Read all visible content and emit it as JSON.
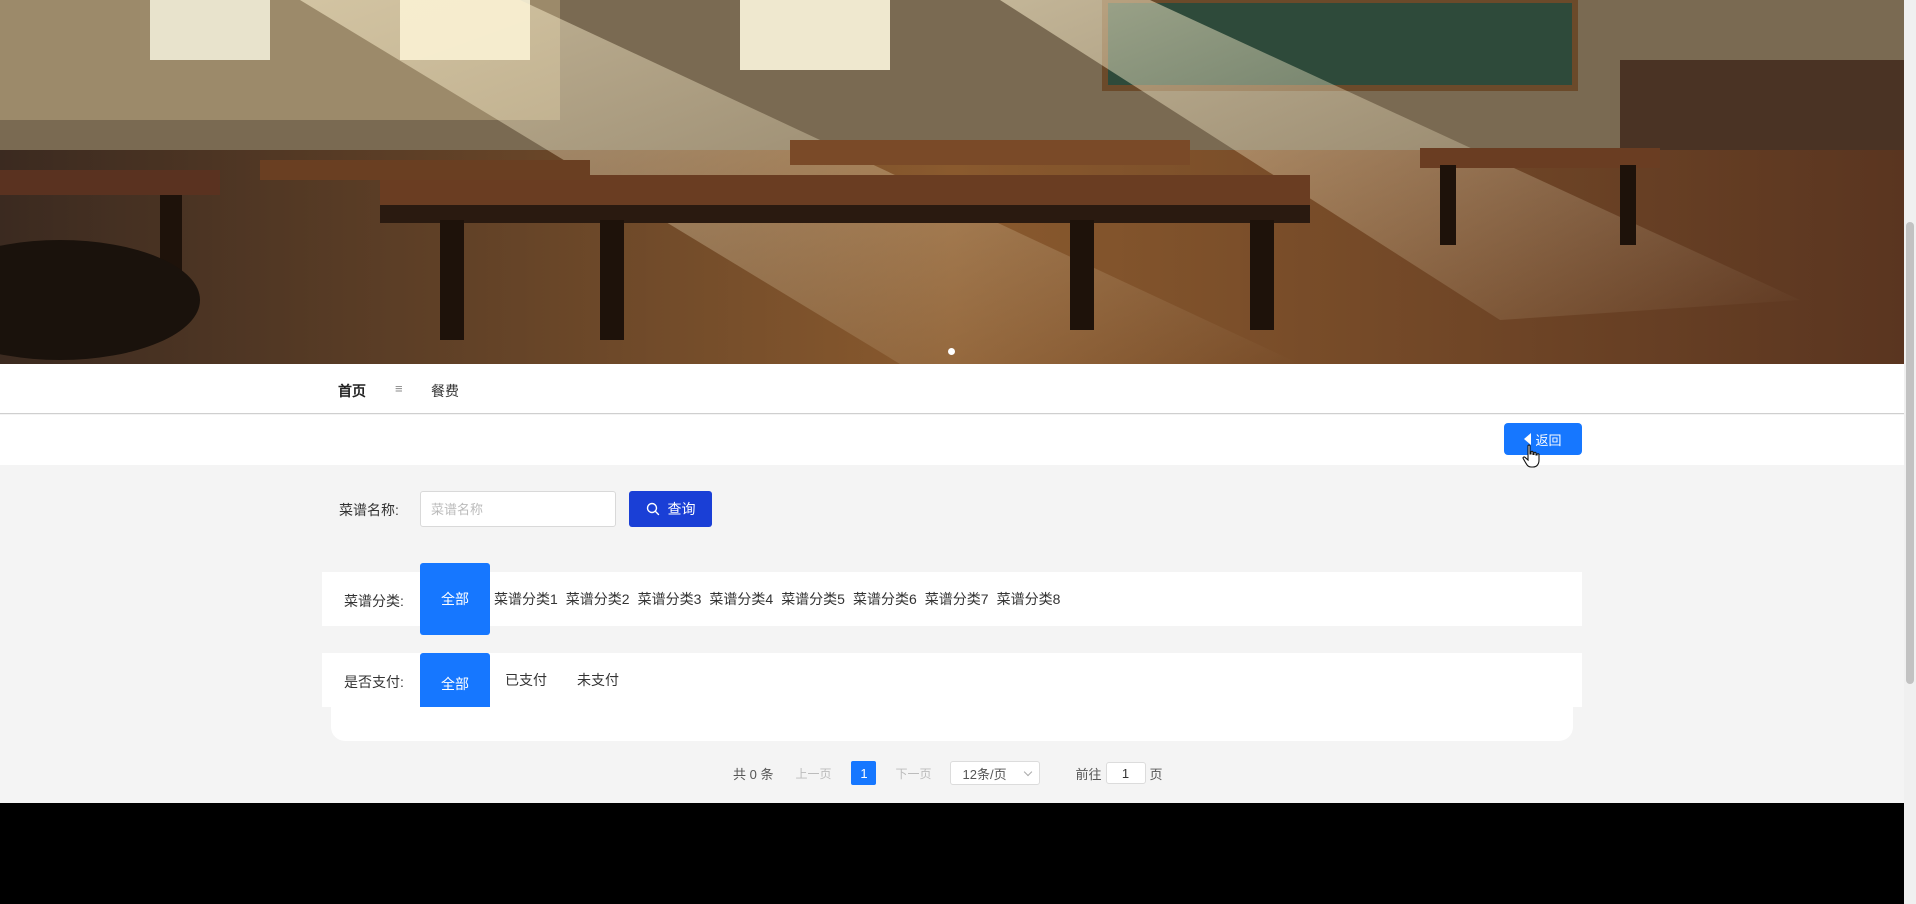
{
  "nav": {
    "home": "首页",
    "separator": "≡",
    "current": "餐费"
  },
  "back_button": {
    "label": "返回"
  },
  "search": {
    "label": "菜谱名称:",
    "placeholder": "菜谱名称",
    "value": "",
    "button_label": "查询"
  },
  "category_filter": {
    "label": "菜谱分类:",
    "options": [
      "全部",
      "菜谱分类1",
      "菜谱分类2",
      "菜谱分类3",
      "菜谱分类4",
      "菜谱分类5",
      "菜谱分类6",
      "菜谱分类7",
      "菜谱分类8"
    ],
    "selected": "全部"
  },
  "payment_filter": {
    "label": "是否支付:",
    "options": [
      "全部",
      "已支付",
      "未支付"
    ],
    "selected": "全部"
  },
  "pagination": {
    "total": "共 0 条",
    "prev": "上一页",
    "current_page": "1",
    "next": "下一页",
    "page_size": "12条/页",
    "goto_label": "前往",
    "goto_value": "1",
    "goto_suffix": "页"
  },
  "colors": {
    "primary": "#1677ff",
    "search_button": "#1a3fd6"
  }
}
